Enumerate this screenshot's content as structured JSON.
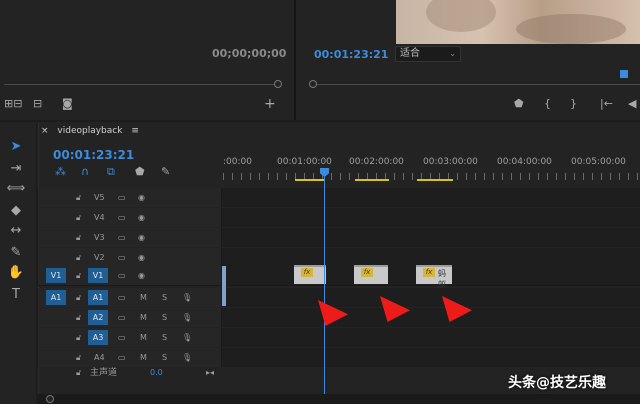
{
  "source": {
    "timecode": "00;00;00;00"
  },
  "program": {
    "timecode": "00:01:23:21",
    "fit_label": "适合"
  },
  "timeline": {
    "tab_title": "videoplayback",
    "timecode": "00:01:23:21",
    "ruler_labels": [
      ":00:00",
      "00:01:00:00",
      "00:02:00:00",
      "00:03:00:00",
      "00:04:00:00",
      "00:05:00:00"
    ],
    "video_tracks": [
      "V5",
      "V4",
      "V3",
      "V2",
      "V1"
    ],
    "audio_tracks": [
      "A1",
      "A2",
      "A3",
      "A4"
    ],
    "source_v": "V1",
    "source_a": "A1",
    "mute_label": "M",
    "solo_label": "S",
    "master_label": "主声道",
    "master_value": "0.0",
    "clip_label": "fx",
    "clip3_name": "蚂蚁"
  },
  "colors": {
    "accent": "#3d8bdc",
    "arrow": "#ee1b1b",
    "work_area": "#d7c418"
  },
  "watermark": "头条@技艺乐趣"
}
